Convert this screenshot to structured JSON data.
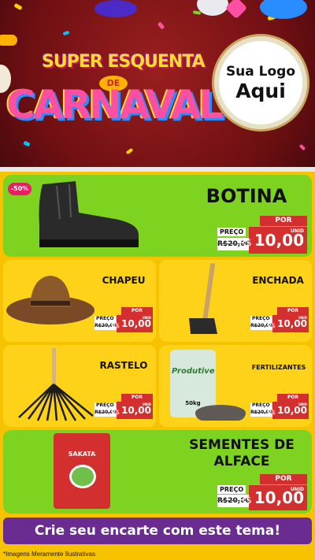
{
  "header": {
    "title_top": "SUPER ESQUENTA",
    "title_connector": "DE",
    "title_main": "CARNAVAL",
    "logo_line1": "Sua Logo",
    "logo_line2": "Aqui"
  },
  "products": [
    {
      "name": "BOTINA",
      "badge": "-50%",
      "por_label": "POR",
      "preco_label": "PREÇO",
      "old_price": "R$20,00",
      "currency": "R$",
      "price": "10,00",
      "unit": "UNID"
    },
    {
      "name": "CHAPEU",
      "por_label": "POR",
      "preco_label": "PREÇO",
      "old_price": "R$20,00",
      "currency": "R$",
      "price": "10,00",
      "unit": "UNID"
    },
    {
      "name": "ENCHADA",
      "por_label": "POR",
      "preco_label": "PREÇO",
      "old_price": "R$20,00",
      "currency": "R$",
      "price": "10,00",
      "unit": "UNID"
    },
    {
      "name": "RASTELO",
      "por_label": "POR",
      "preco_label": "PREÇO",
      "old_price": "R$20,00",
      "currency": "R$",
      "price": "10,00",
      "unit": "UNID"
    },
    {
      "name": "FERTILIZANTES",
      "por_label": "POR",
      "preco_label": "PREÇO",
      "old_price": "R$20,00",
      "currency": "R$",
      "price": "10,00",
      "unit": "UNID",
      "package_brand": "Produtive",
      "package_weight": "50kg"
    },
    {
      "name_line1": "SEMENTES DE",
      "name_line2": "ALFACE",
      "por_label": "POR",
      "preco_label": "PREÇO",
      "old_price": "R$20,00",
      "currency": "R$",
      "price": "10,00",
      "unit": "UNID",
      "package_brand": "SAKATA"
    }
  ],
  "cta": "Crie seu encarte com este tema!",
  "disclaimer": "*Imagens Meramente Ilustrativas",
  "colors": {
    "header_bg": "#7a1414",
    "main_bg": "#f7c300",
    "green_card": "#7ed321",
    "yellow_card": "#ffd21a",
    "price_red": "#d32f2f",
    "cta_purple": "#6a2c91"
  }
}
